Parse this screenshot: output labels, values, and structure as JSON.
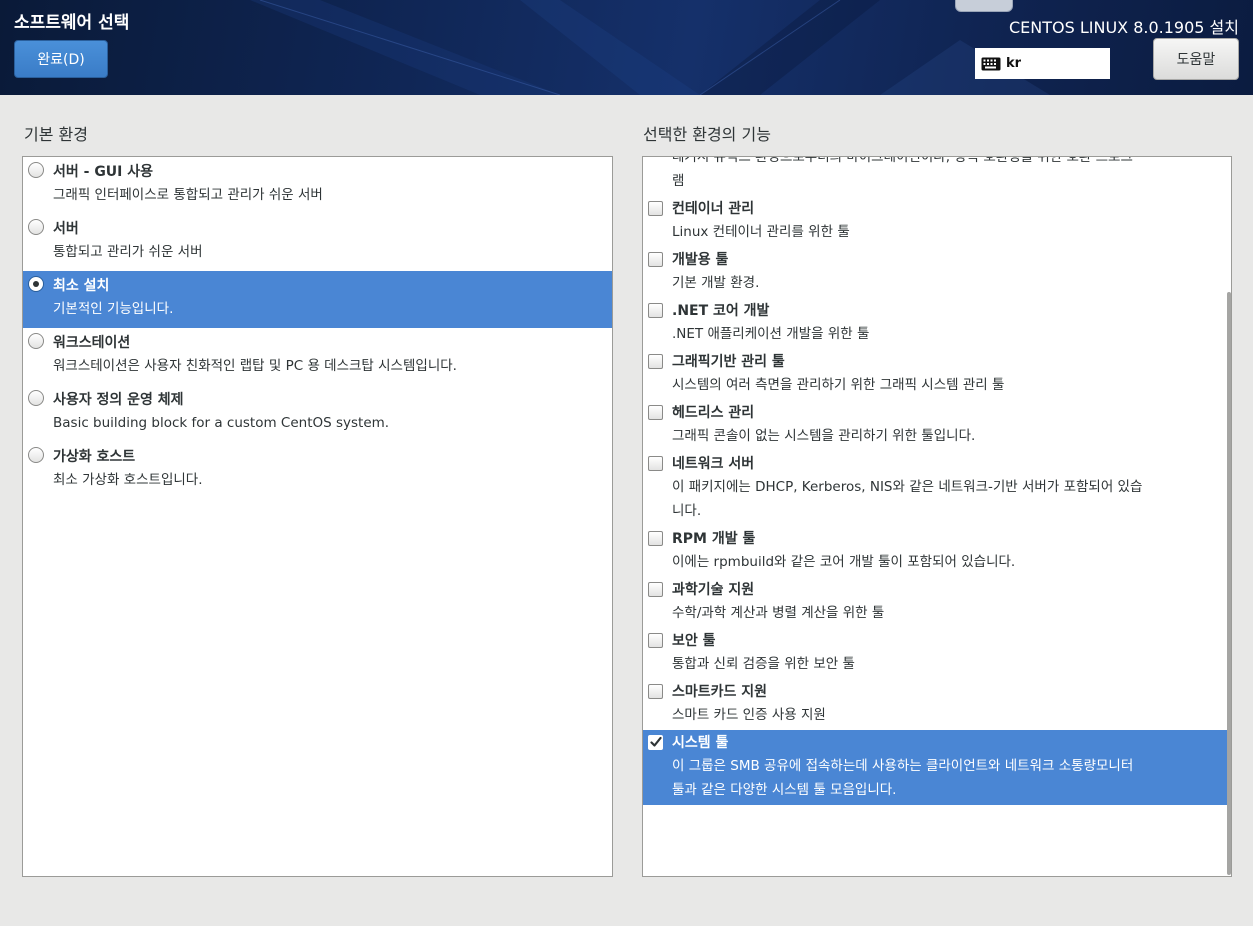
{
  "header": {
    "title": "소프트웨어 선택",
    "done_label": "완료(D)",
    "product": "CENTOS LINUX 8.0.1905 설치",
    "keyboard_layout": "kr",
    "help_label": "도움말"
  },
  "base_env": {
    "title": "기본 환경",
    "items": [
      {
        "name": "서버 - GUI 사용",
        "desc": "그래픽 인터페이스로 통합되고 관리가 쉬운 서버",
        "selected": false
      },
      {
        "name": "서버",
        "desc": "통합되고 관리가 쉬운 서버",
        "selected": false
      },
      {
        "name": "최소 설치",
        "desc": "기본적인 기능입니다.",
        "selected": true
      },
      {
        "name": "워크스테이션",
        "desc": "워크스테이션은 사용자 친화적인 랩탑 및 PC 용 데스크탑 시스템입니다.",
        "selected": false
      },
      {
        "name": "사용자 정의 운영 체제",
        "desc": "Basic building block for a custom CentOS system.",
        "selected": false
      },
      {
        "name": "가상화 호스트",
        "desc": "최소 가상화 호스트입니다.",
        "selected": false
      }
    ]
  },
  "addons": {
    "title": "선택한 환경의 기능",
    "partial_top": "레거시 유닉스 환경으로부터의 마이그레이션이나, 상속 호환성을 위한 호환 프로그\n램",
    "items": [
      {
        "name": "컨테이너 관리",
        "desc": "Linux 컨테이너 관리를 위한 툴",
        "checked": false
      },
      {
        "name": "개발용 툴",
        "desc": "기본 개발 환경.",
        "checked": false
      },
      {
        "name": ".NET 코어 개발",
        "desc": ".NET 애플리케이션 개발을 위한 툴",
        "checked": false
      },
      {
        "name": "그래픽기반 관리 툴",
        "desc": "시스템의 여러 측면을 관리하기 위한 그래픽 시스템 관리 툴",
        "checked": false
      },
      {
        "name": "헤드리스 관리",
        "desc": "그래픽 콘솔이 없는 시스템을 관리하기 위한 툴입니다.",
        "checked": false
      },
      {
        "name": "네트워크 서버",
        "desc": "이 패키지에는 DHCP, Kerberos, NIS와 같은 네트워크-기반 서버가 포함되어 있습\n니다.",
        "checked": false
      },
      {
        "name": "RPM 개발 툴",
        "desc": "이에는 rpmbuild와 같은 코어 개발 툴이 포함되어 있습니다.",
        "checked": false
      },
      {
        "name": "과학기술 지원",
        "desc": "수학/과학 계산과 병렬 계산을 위한 툴",
        "checked": false
      },
      {
        "name": "보안 툴",
        "desc": "통합과 신뢰 검증을 위한 보안 툴",
        "checked": false
      },
      {
        "name": "스마트카드 지원",
        "desc": "스마트 카드 인증 사용 지원",
        "checked": false
      },
      {
        "name": "시스템 툴",
        "desc": "이 그룹은 SMB 공유에 접속하는데 사용하는 클라이언트와 네트워크 소통량모니터\n툴과 같은 다양한 시스템 툴 모음입니다.",
        "checked": true
      }
    ]
  }
}
